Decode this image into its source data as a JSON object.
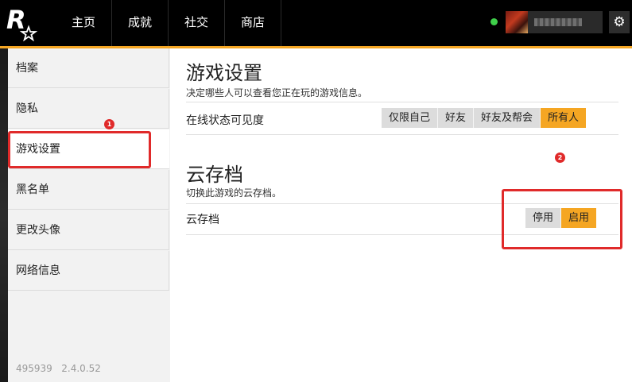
{
  "nav": {
    "items": [
      "主页",
      "成就",
      "社交",
      "商店"
    ]
  },
  "header": {
    "logo_icon": "rockstar-logo-icon",
    "online_status_color": "#3fcf4a",
    "settings_icon": "gear-icon"
  },
  "sidebar": {
    "items": [
      {
        "label": "档案",
        "active": false
      },
      {
        "label": "隐私",
        "active": false
      },
      {
        "label": "游戏设置",
        "active": true
      },
      {
        "label": "黑名单",
        "active": false
      },
      {
        "label": "更改头像",
        "active": false
      },
      {
        "label": "网络信息",
        "active": false
      }
    ],
    "version_id": "495939",
    "version_number": "2.4.0.52"
  },
  "game_settings": {
    "title": "游戏设置",
    "subtitle": "决定哪些人可以查看您正在玩的游戏信息。",
    "row_label": "在线状态可见度",
    "options": [
      "仅限自己",
      "好友",
      "好友及帮会",
      "所有人"
    ],
    "selected": "所有人"
  },
  "cloud_save": {
    "title": "云存档",
    "subtitle": "切换此游戏的云存档。",
    "row_label": "云存档",
    "options": [
      "停用",
      "启用"
    ],
    "selected": "启用"
  },
  "annotations": {
    "marker_1": "1",
    "marker_2": "2",
    "color": "#e02a2a"
  },
  "colors": {
    "accent": "#f5a623",
    "topbar": "#000000"
  }
}
